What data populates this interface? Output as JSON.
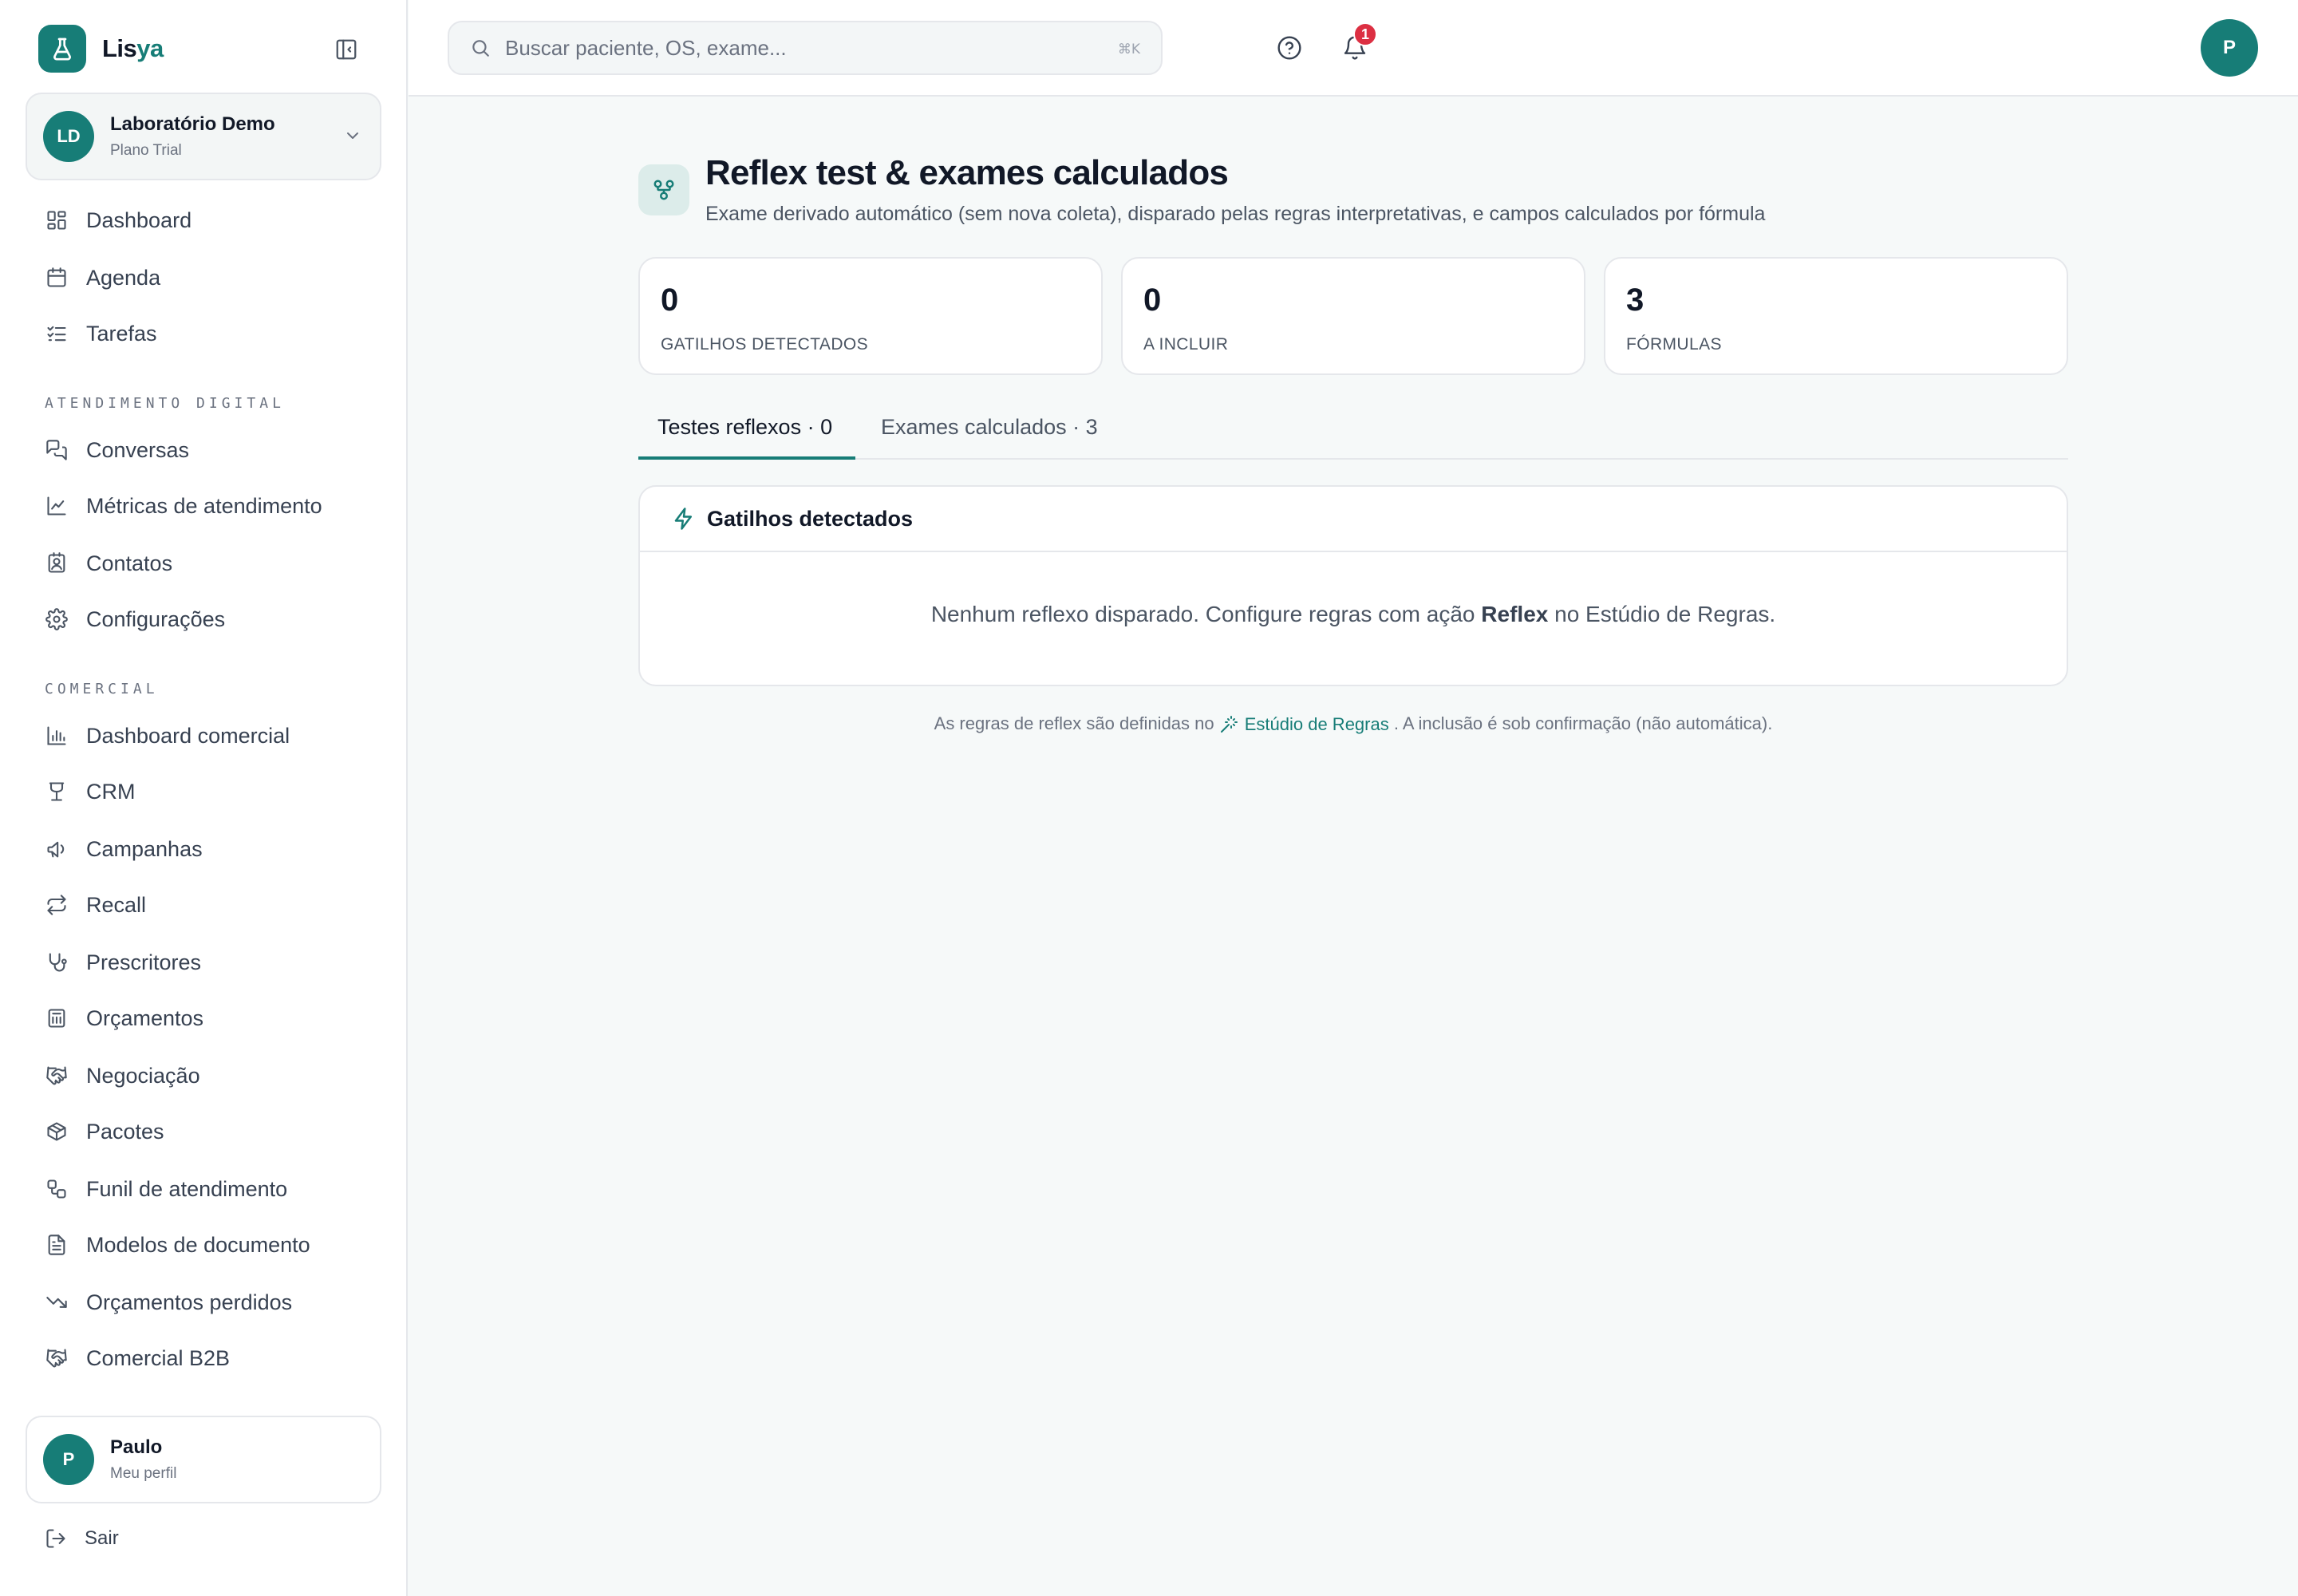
{
  "brand": {
    "name_main": "Lis",
    "name_accent": "ya"
  },
  "org": {
    "initials": "LD",
    "name": "Laboratório Demo",
    "plan": "Plano Trial"
  },
  "nav": {
    "main": [
      {
        "label": "Dashboard",
        "icon": "layout-dashboard-icon"
      },
      {
        "label": "Agenda",
        "icon": "calendar-icon"
      },
      {
        "label": "Tarefas",
        "icon": "list-checks-icon"
      }
    ],
    "section_digital": "ATENDIMENTO DIGITAL",
    "digital": [
      {
        "label": "Conversas",
        "icon": "messages-icon"
      },
      {
        "label": "Métricas de atendimento",
        "icon": "line-chart-icon"
      },
      {
        "label": "Contatos",
        "icon": "contact-icon"
      },
      {
        "label": "Configurações",
        "icon": "gear-icon"
      }
    ],
    "section_comercial": "COMERCIAL",
    "comercial": [
      {
        "label": "Dashboard comercial",
        "icon": "bar-chart-icon"
      },
      {
        "label": "CRM",
        "icon": "crm-icon"
      },
      {
        "label": "Campanhas",
        "icon": "megaphone-icon"
      },
      {
        "label": "Recall",
        "icon": "repeat-icon"
      },
      {
        "label": "Prescritores",
        "icon": "stethoscope-icon"
      },
      {
        "label": "Orçamentos",
        "icon": "calculator-icon"
      },
      {
        "label": "Negociação",
        "icon": "handshake-icon"
      },
      {
        "label": "Pacotes",
        "icon": "package-icon"
      },
      {
        "label": "Funil de atendimento",
        "icon": "workflow-icon"
      },
      {
        "label": "Modelos de documento",
        "icon": "document-icon"
      },
      {
        "label": "Orçamentos perdidos",
        "icon": "trending-down-icon"
      },
      {
        "label": "Comercial B2B",
        "icon": "handshake-icon"
      }
    ]
  },
  "profile": {
    "initial": "P",
    "name": "Paulo",
    "subtitle": "Meu perfil"
  },
  "logout_label": "Sair",
  "search": {
    "placeholder": "Buscar paciente, OS, exame...",
    "shortcut": "⌘K"
  },
  "notifications": {
    "count": "1"
  },
  "user_avatar_initial": "P",
  "page": {
    "title": "Reflex test & exames calculados",
    "subtitle": "Exame derivado automático (sem nova coleta), disparado pelas regras interpretativas, e campos calculados por fórmula"
  },
  "stats": [
    {
      "value": "0",
      "label": "GATILHOS DETECTADOS"
    },
    {
      "value": "0",
      "label": "A INCLUIR"
    },
    {
      "value": "3",
      "label": "FÓRMULAS"
    }
  ],
  "tabs": [
    {
      "label": "Testes reflexos · 0",
      "active": true
    },
    {
      "label": "Exames calculados · 3",
      "active": false
    }
  ],
  "panel": {
    "title": "Gatilhos detectados",
    "empty_before": "Nenhum reflexo disparado. Configure regras com ação ",
    "empty_bold": "Reflex",
    "empty_after": " no Estúdio de Regras."
  },
  "footer": {
    "before": "As regras de reflex são definidas no ",
    "link": "Estúdio de Regras",
    "after": " . A inclusão é sob confirmação (não automática)."
  },
  "colors": {
    "accent": "#177d77",
    "badge": "#dc2f42",
    "background": "#f6f9f9"
  }
}
